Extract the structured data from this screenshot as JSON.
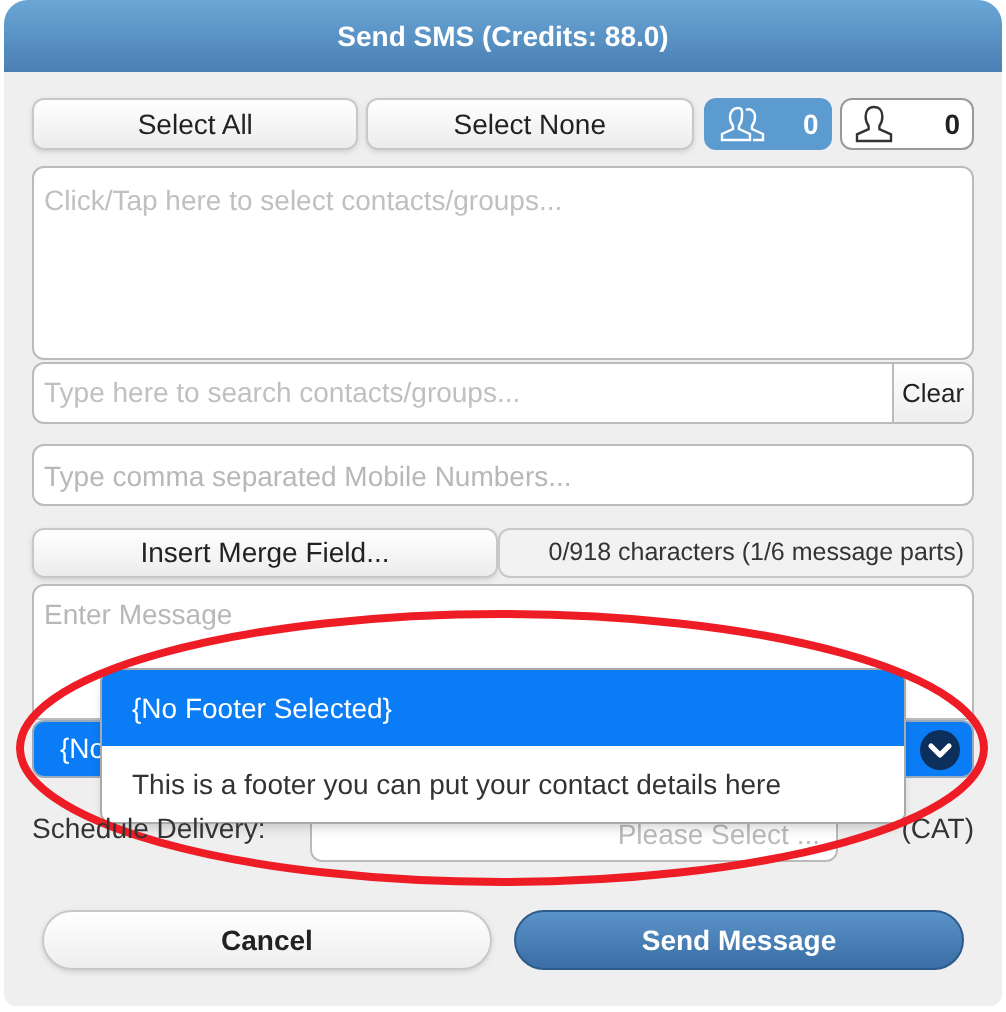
{
  "title": "Send SMS (Credits: 88.0)",
  "selection_buttons": [
    "Select All",
    "Select None"
  ],
  "counters": [
    {
      "kind": "group",
      "count": "0",
      "selected": true
    },
    {
      "kind": "person",
      "count": "0",
      "selected": false
    }
  ],
  "contacts_box": {
    "placeholder": "Click/Tap here to select contacts/groups..."
  },
  "search": {
    "placeholder": "Type here to search contacts/groups...",
    "clear_label": "Clear"
  },
  "mobile_numbers": {
    "placeholder": "Type comma separated Mobile Numbers..."
  },
  "merge_field_button": "Insert Merge Field...",
  "character_count": "0/918 characters (1/6 message parts)",
  "message": {
    "placeholder": "Enter Message"
  },
  "footer_select": {
    "value": "{No",
    "options": [
      {
        "label": "{No Footer Selected}",
        "selected": true
      },
      {
        "label": "This is a footer you can put your contact details here",
        "selected": false
      }
    ]
  },
  "schedule": {
    "label": "Schedule Delivery:",
    "placeholder": "Please Select ...",
    "timezone": "(CAT)"
  },
  "actions": [
    {
      "kind": "secondary",
      "label": "Cancel"
    },
    {
      "kind": "primary",
      "label": "Send Message"
    }
  ]
}
